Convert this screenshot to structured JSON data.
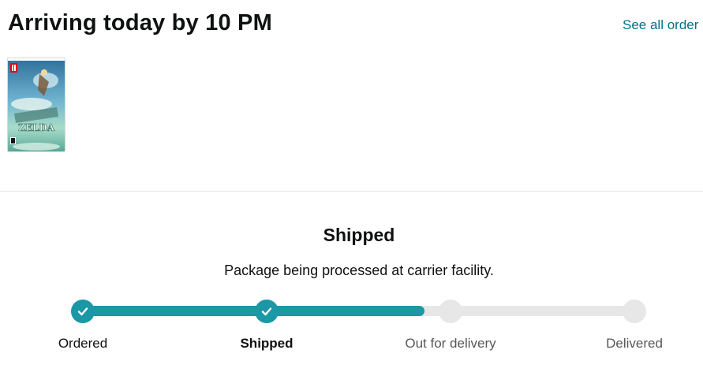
{
  "header": {
    "title": "Arriving today by 10 PM",
    "see_all_label": "See all order"
  },
  "product": {
    "image_icon": "game-box-art-icon",
    "box_brand": "ZELDA"
  },
  "status": {
    "title": "Shipped",
    "subtitle": "Package being processed at carrier facility."
  },
  "progress": {
    "current_step_index": 1,
    "fill_fraction": 0.62,
    "accent_color": "#1a98a5",
    "inactive_color": "#e7e7e7",
    "steps": [
      {
        "label": "Ordered",
        "state": "done"
      },
      {
        "label": "Shipped",
        "state": "done"
      },
      {
        "label": "Out for delivery",
        "state": "pending"
      },
      {
        "label": "Delivered",
        "state": "pending"
      }
    ]
  },
  "colors": {
    "link": "#007185",
    "text": "#0f1111",
    "divider": "#e3e6e6"
  }
}
